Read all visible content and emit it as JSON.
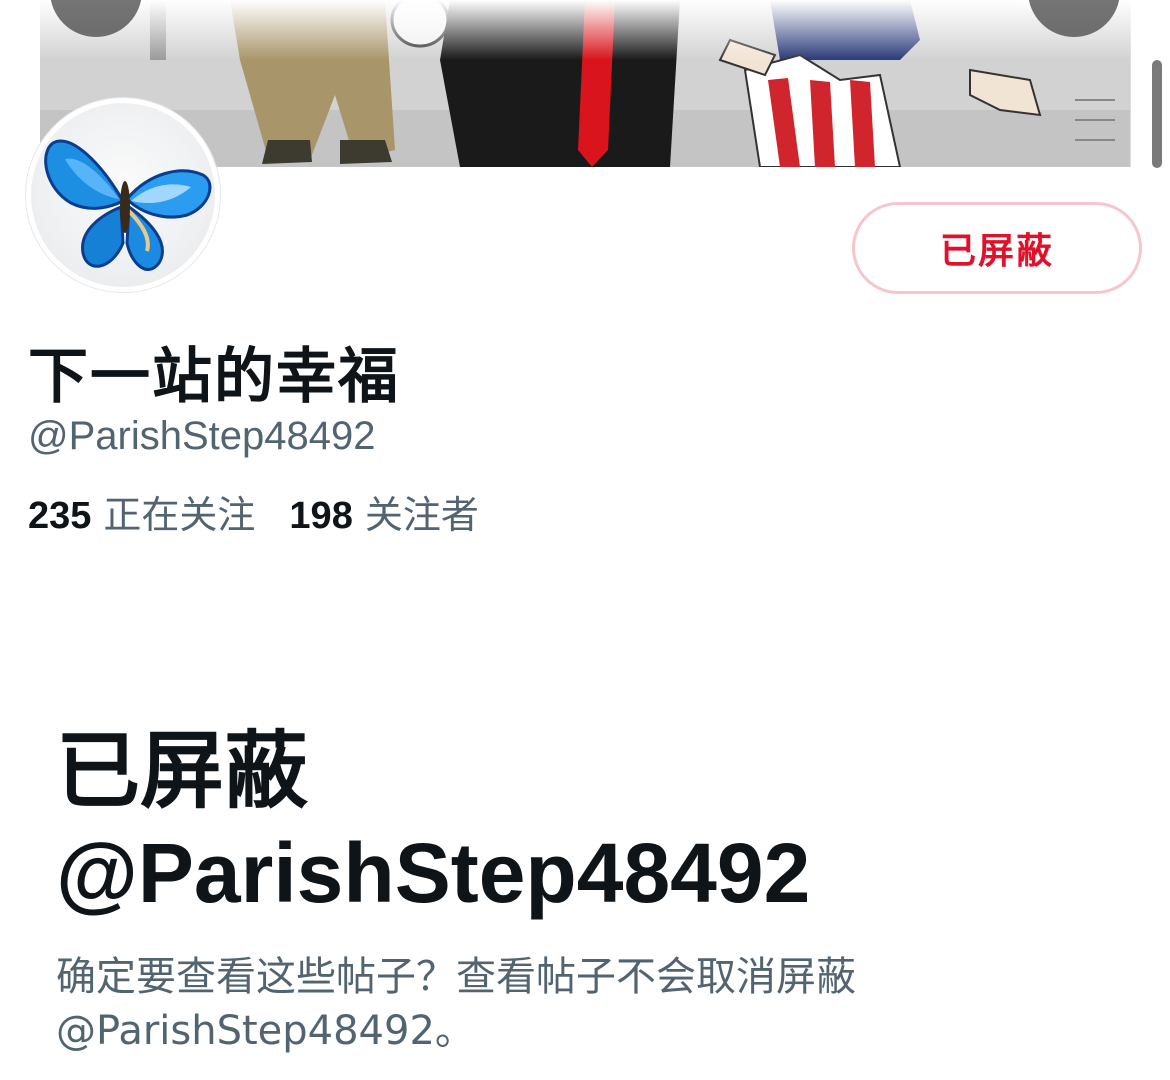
{
  "profile": {
    "display_name": "下一站的幸福",
    "handle": "@ParishStep48492",
    "following_count": "235",
    "following_label": "正在关注",
    "followers_count": "198",
    "followers_label": "关注者",
    "blocked_button_label": "已屏蔽"
  },
  "notice": {
    "title": "已屏蔽",
    "handle": "@ParishStep48492",
    "body_line1": "确定要查看这些帖子？查看帖子不会取消屏蔽",
    "body_line2": "@ParishStep48492。"
  },
  "icons": {
    "back": "back-arrow-icon",
    "search": "search-icon",
    "more": "more-icon"
  },
  "colors": {
    "blocked_red": "#e0122b",
    "blocked_border": "#f6c6cd",
    "text_primary": "#0f1419",
    "text_secondary": "#536471"
  }
}
